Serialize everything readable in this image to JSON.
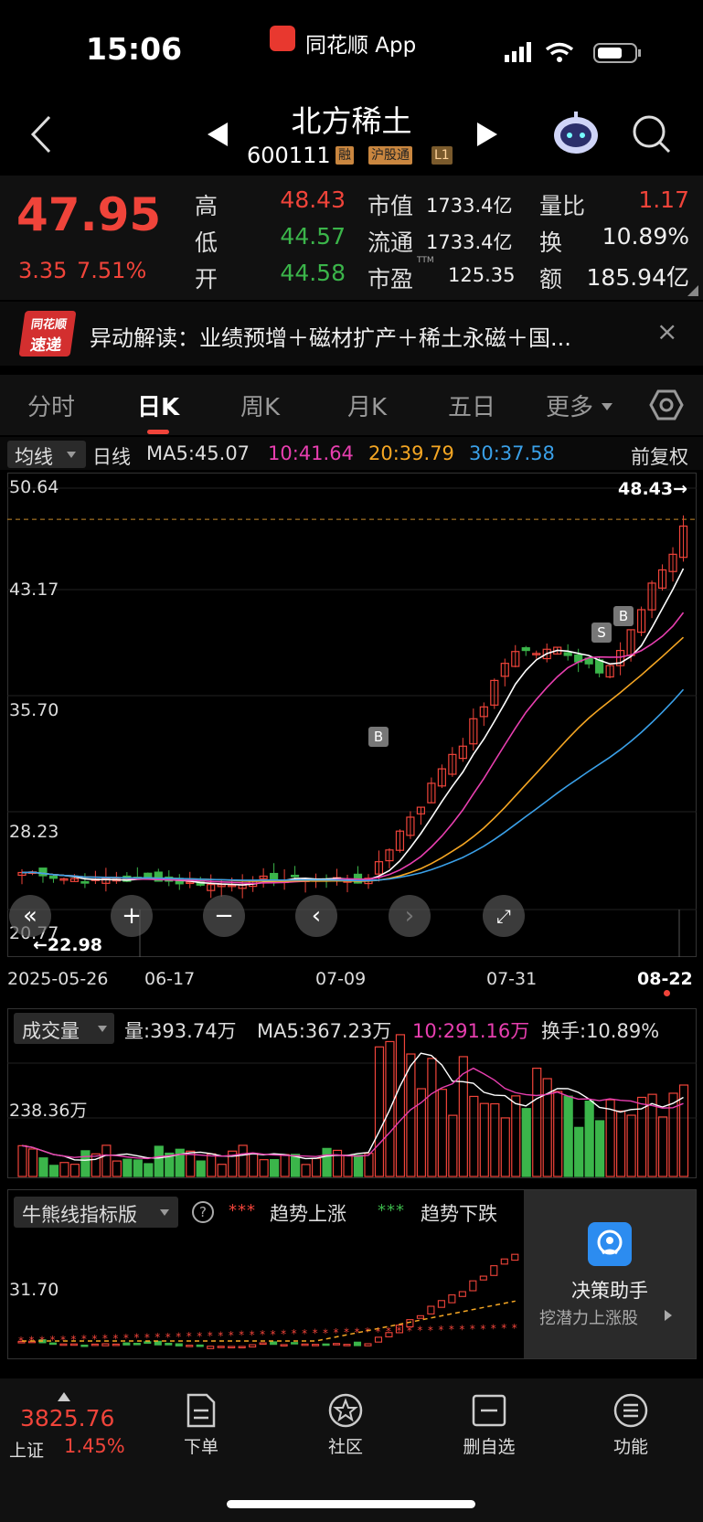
{
  "status_bar": {
    "time": "15:06",
    "app": "同花顺 App"
  },
  "header": {
    "stock_name": "北方稀土",
    "stock_code": "600111",
    "tags": [
      "融",
      "沪股通",
      "L1"
    ]
  },
  "quote": {
    "price": "47.95",
    "change": "3.35",
    "change_pct": "7.51%",
    "high_label": "高",
    "high": "48.43",
    "low_label": "低",
    "low": "44.57",
    "open_label": "开",
    "open": "44.58",
    "mktcap_label": "市值",
    "mktcap": "1733.4亿",
    "float_label": "流通",
    "float": "1733.4亿",
    "pe_label": "市盈",
    "pe_sup": "TTM",
    "pe": "125.35",
    "vol_ratio_label": "量比",
    "vol_ratio": "1.17",
    "turnover_label": "换",
    "turnover": "10.89%",
    "amount_label": "额",
    "amount": "185.94亿"
  },
  "banner": {
    "logo_top": "同花顺",
    "logo_bottom": "速递",
    "text": "异动解读：业绩预增＋磁材扩产＋稀土永磁＋国...",
    "close": "×"
  },
  "tabs": [
    "分时",
    "日K",
    "周K",
    "月K",
    "五日",
    "更多"
  ],
  "active_tab": "日K",
  "ma_bar": {
    "selector": "均线",
    "period": "日线",
    "ma5": "MA5:45.07",
    "ma10": "10:41.64",
    "ma20": "20:39.79",
    "ma30": "30:37.58",
    "adjust": "前复权"
  },
  "kline": {
    "y_labels": [
      "50.64",
      "43.17",
      "35.70",
      "28.23",
      "20.77"
    ],
    "max_marker": "48.43→",
    "min_marker": "←22.98",
    "x_labels": [
      "2025-05-26",
      "06-17",
      "07-09",
      "07-31",
      "08-22"
    ],
    "signals": [
      "B",
      "S",
      "B"
    ]
  },
  "volume": {
    "selector": "成交量",
    "vol": "量:393.74万",
    "ma5": "MA5:367.23万",
    "ma10": "10:291.16万",
    "turnover": "换手:10.89%",
    "y_label": "238.36万"
  },
  "indicator": {
    "selector": "牛熊线指标版",
    "help": "?",
    "up_label": "趋势上涨",
    "down_label": "趋势下跌",
    "y_label": "31.70",
    "assistant_title": "决策助手",
    "assistant_sub": "挖潜力上涨股"
  },
  "bottom": {
    "index_value": "3825.76",
    "index_name": "上证",
    "index_pct": "1.45%",
    "order": "下单",
    "community": "社区",
    "remove": "删自选",
    "functions": "功能"
  },
  "colors": {
    "up": "#f0443a",
    "down": "#3bb54a",
    "ma5": "#ffffff",
    "ma10": "#e83fb0",
    "ma20": "#f5a623",
    "ma30": "#3aa0e8"
  }
}
